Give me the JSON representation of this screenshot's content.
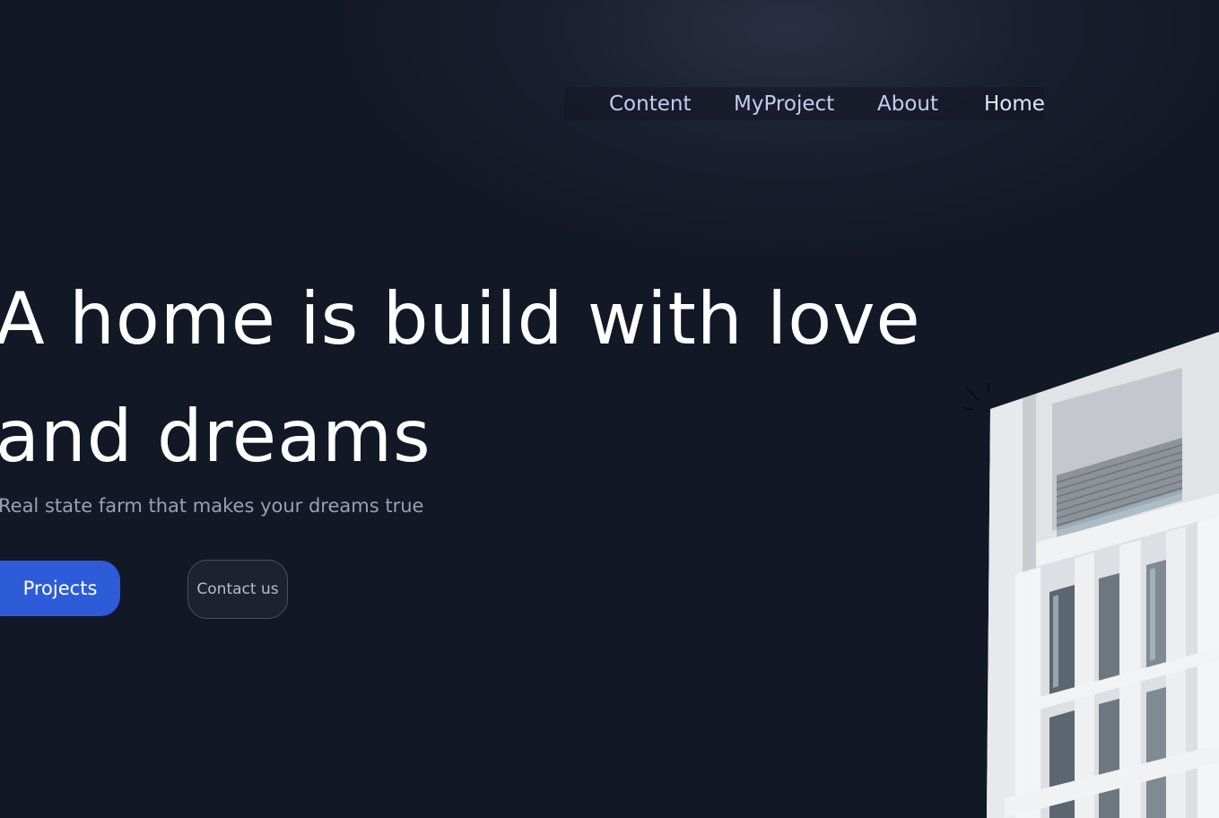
{
  "nav": {
    "items": [
      {
        "label": "Content"
      },
      {
        "label": "MyProject"
      },
      {
        "label": "About"
      },
      {
        "label": "Home"
      }
    ]
  },
  "hero": {
    "headline_line1": "A home is build with love",
    "headline_line2": "and dreams",
    "subtitle": "Real state farm that makes your dreams true"
  },
  "buttons": {
    "projects_label": "Projects",
    "contact_label": "Contact us"
  },
  "colors": {
    "background": "#131826",
    "nav_text": "#c7cbf2",
    "primary_button": "#2e5bd8",
    "secondary_button": "#1d2230"
  },
  "image": {
    "icon": "building-photo"
  }
}
